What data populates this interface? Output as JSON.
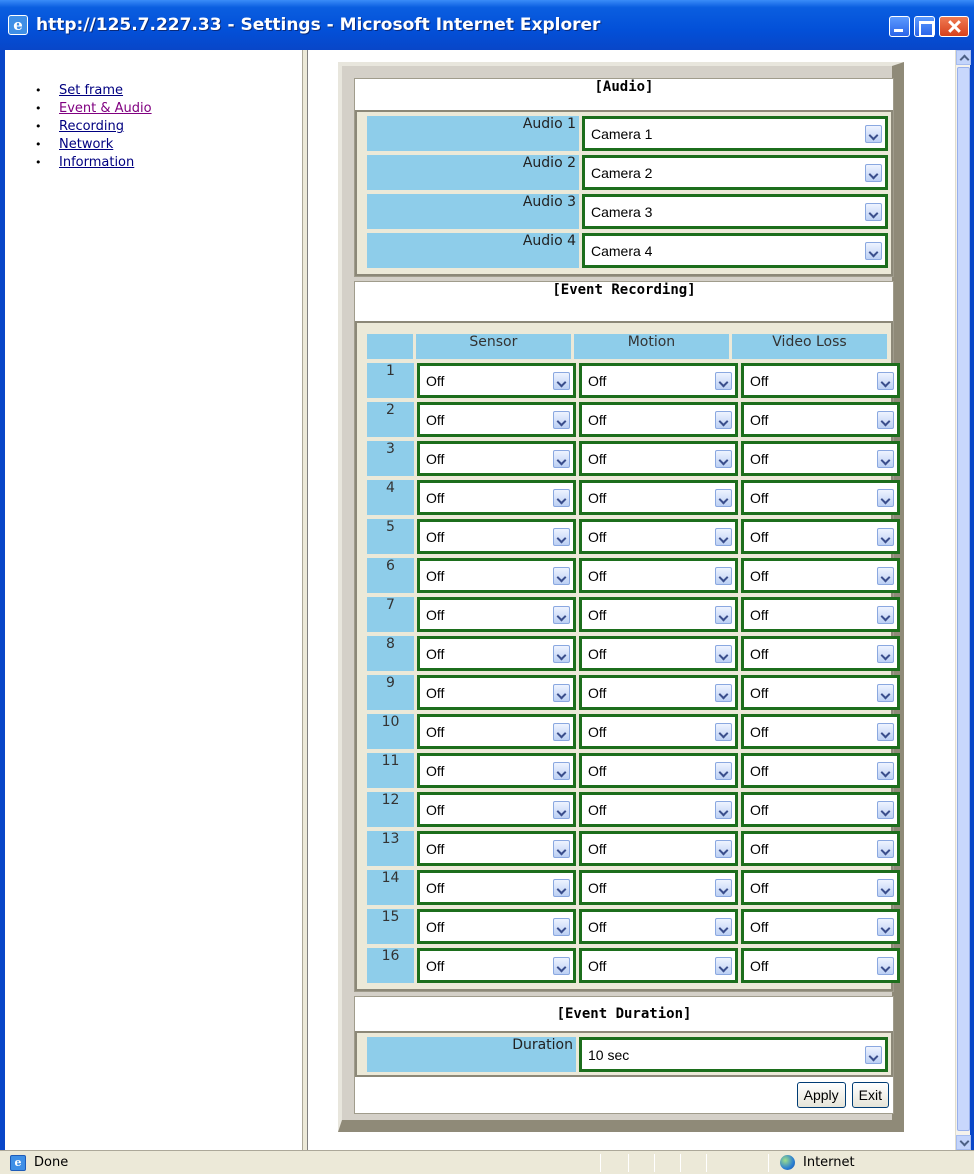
{
  "window": {
    "title": "http://125.7.227.33 - Settings - Microsoft Internet Explorer"
  },
  "nav": {
    "items": [
      {
        "label": "Set frame"
      },
      {
        "label": "Event & Audio"
      },
      {
        "label": "Recording"
      },
      {
        "label": "Network"
      },
      {
        "label": "Information"
      }
    ]
  },
  "audio": {
    "title": "[Audio]",
    "rows": [
      {
        "label": "Audio 1",
        "value": "Camera 1"
      },
      {
        "label": "Audio 2",
        "value": "Camera 2"
      },
      {
        "label": "Audio 3",
        "value": "Camera 3"
      },
      {
        "label": "Audio 4",
        "value": "Camera 4"
      }
    ]
  },
  "event_recording": {
    "title": "[Event Recording]",
    "columns": [
      "Sensor",
      "Motion",
      "Video Loss"
    ],
    "rows": [
      {
        "num": "1",
        "sensor": "Off",
        "motion": "Off",
        "video_loss": "Off"
      },
      {
        "num": "2",
        "sensor": "Off",
        "motion": "Off",
        "video_loss": "Off"
      },
      {
        "num": "3",
        "sensor": "Off",
        "motion": "Off",
        "video_loss": "Off"
      },
      {
        "num": "4",
        "sensor": "Off",
        "motion": "Off",
        "video_loss": "Off"
      },
      {
        "num": "5",
        "sensor": "Off",
        "motion": "Off",
        "video_loss": "Off"
      },
      {
        "num": "6",
        "sensor": "Off",
        "motion": "Off",
        "video_loss": "Off"
      },
      {
        "num": "7",
        "sensor": "Off",
        "motion": "Off",
        "video_loss": "Off"
      },
      {
        "num": "8",
        "sensor": "Off",
        "motion": "Off",
        "video_loss": "Off"
      },
      {
        "num": "9",
        "sensor": "Off",
        "motion": "Off",
        "video_loss": "Off"
      },
      {
        "num": "10",
        "sensor": "Off",
        "motion": "Off",
        "video_loss": "Off"
      },
      {
        "num": "11",
        "sensor": "Off",
        "motion": "Off",
        "video_loss": "Off"
      },
      {
        "num": "12",
        "sensor": "Off",
        "motion": "Off",
        "video_loss": "Off"
      },
      {
        "num": "13",
        "sensor": "Off",
        "motion": "Off",
        "video_loss": "Off"
      },
      {
        "num": "14",
        "sensor": "Off",
        "motion": "Off",
        "video_loss": "Off"
      },
      {
        "num": "15",
        "sensor": "Off",
        "motion": "Off",
        "video_loss": "Off"
      },
      {
        "num": "16",
        "sensor": "Off",
        "motion": "Off",
        "video_loss": "Off"
      }
    ]
  },
  "event_duration": {
    "title": "[Event Duration]",
    "label": "Duration",
    "value": "10 sec"
  },
  "buttons": {
    "apply": "Apply",
    "exit": "Exit"
  },
  "statusbar": {
    "text": "Done",
    "zone": "Internet"
  },
  "colors": {
    "title_bar": "#0350d8",
    "label_cell": "#8ecdea",
    "select_border": "#1c6e1c",
    "panel": "#d4d0c8"
  }
}
